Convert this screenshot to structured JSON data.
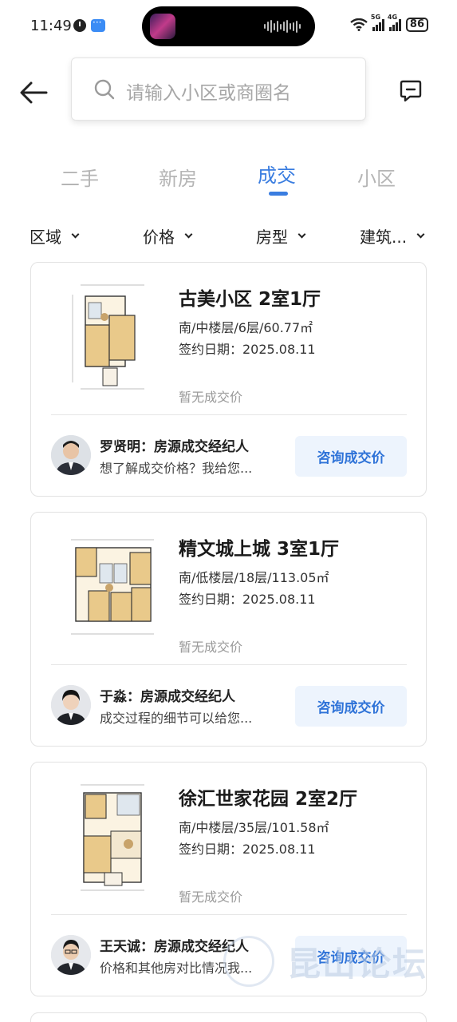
{
  "status_bar": {
    "time": "11:49",
    "net1": "5G",
    "net2": "4G",
    "battery": "86"
  },
  "search": {
    "placeholder": "请输入小区或商圈名"
  },
  "tabs": [
    {
      "label": "二手"
    },
    {
      "label": "新房"
    },
    {
      "label": "成交"
    },
    {
      "label": "小区"
    }
  ],
  "filters": [
    {
      "label": "区域"
    },
    {
      "label": "价格"
    },
    {
      "label": "房型"
    },
    {
      "label": "建筑..."
    }
  ],
  "listings": [
    {
      "title": "古美小区 2室1厅",
      "info": "南/中楼层/6层/60.77㎡",
      "date": "签约日期：2025.08.11",
      "price": "暂无成交价",
      "agent_name": "罗贤明：房源成交经纪人",
      "agent_msg": "想了解成交价格？我给您...",
      "button": "咨询成交价"
    },
    {
      "title": "精文城上城 3室1厅",
      "info": "南/低楼层/18层/113.05㎡",
      "date": "签约日期：2025.08.11",
      "price": "暂无成交价",
      "agent_name": "于淼：房源成交经纪人",
      "agent_msg": "成交过程的细节可以给您...",
      "button": "咨询成交价"
    },
    {
      "title": "徐汇世家花园 2室2厅",
      "info": "南/中楼层/35层/101.58㎡",
      "date": "签约日期：2025.08.11",
      "price": "暂无成交价",
      "agent_name": "王天诚：房源成交经纪人",
      "agent_msg": "价格和其他房对比情况我...",
      "button": "咨询成交价"
    }
  ],
  "watermark": {
    "text": "昆山论坛"
  },
  "colors": {
    "accent": "#3a7de0",
    "button_bg": "#edf4fd",
    "button_text": "#2f73d8"
  }
}
